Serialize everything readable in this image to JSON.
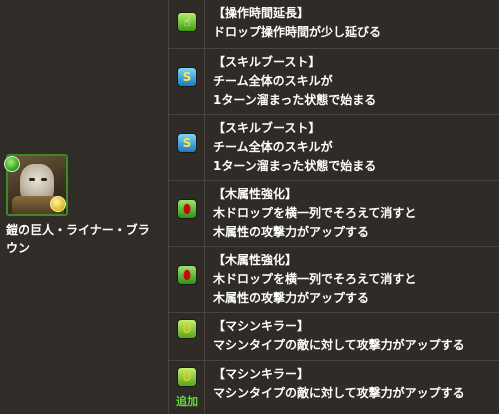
{
  "monster": {
    "name": "鎧の巨人・ライナー・ブラウン",
    "name_line1": "鎧の巨人・ライナー・ブラ",
    "name_line2": "ウン",
    "main_attribute_color": "#3c8a26",
    "sub_attribute_color": "#d9b81d"
  },
  "awakenings": [
    {
      "icon": "pointer-hand-icon",
      "title": "【操作時間延長】",
      "lines": [
        "ドロップ操作時間が少し延びる"
      ]
    },
    {
      "icon": "skill-boost-icon",
      "title": "【スキルブースト】",
      "lines": [
        "チーム全体のスキルが",
        "1ターン溜まった状態で始まる"
      ]
    },
    {
      "icon": "skill-boost-icon",
      "title": "【スキルブースト】",
      "lines": [
        "チーム全体のスキルが",
        "1ターン溜まった状態で始まる"
      ]
    },
    {
      "icon": "wood-enhance-icon",
      "title": "【木属性強化】",
      "lines": [
        "木ドロップを横一列でそろえて消すと",
        "木属性の攻撃力がアップする"
      ]
    },
    {
      "icon": "wood-enhance-icon",
      "title": "【木属性強化】",
      "lines": [
        "木ドロップを横一列でそろえて消すと",
        "木属性の攻撃力がアップする"
      ]
    },
    {
      "icon": "machine-killer-icon",
      "title": "【マシンキラー】",
      "lines": [
        "マシンタイプの敵に対して攻撃力がアップする"
      ]
    },
    {
      "icon": "machine-killer-icon",
      "title": "【マシンキラー】",
      "lines": [
        "マシンタイプの敵に対して攻撃力がアップする"
      ],
      "badge": "追加"
    }
  ]
}
